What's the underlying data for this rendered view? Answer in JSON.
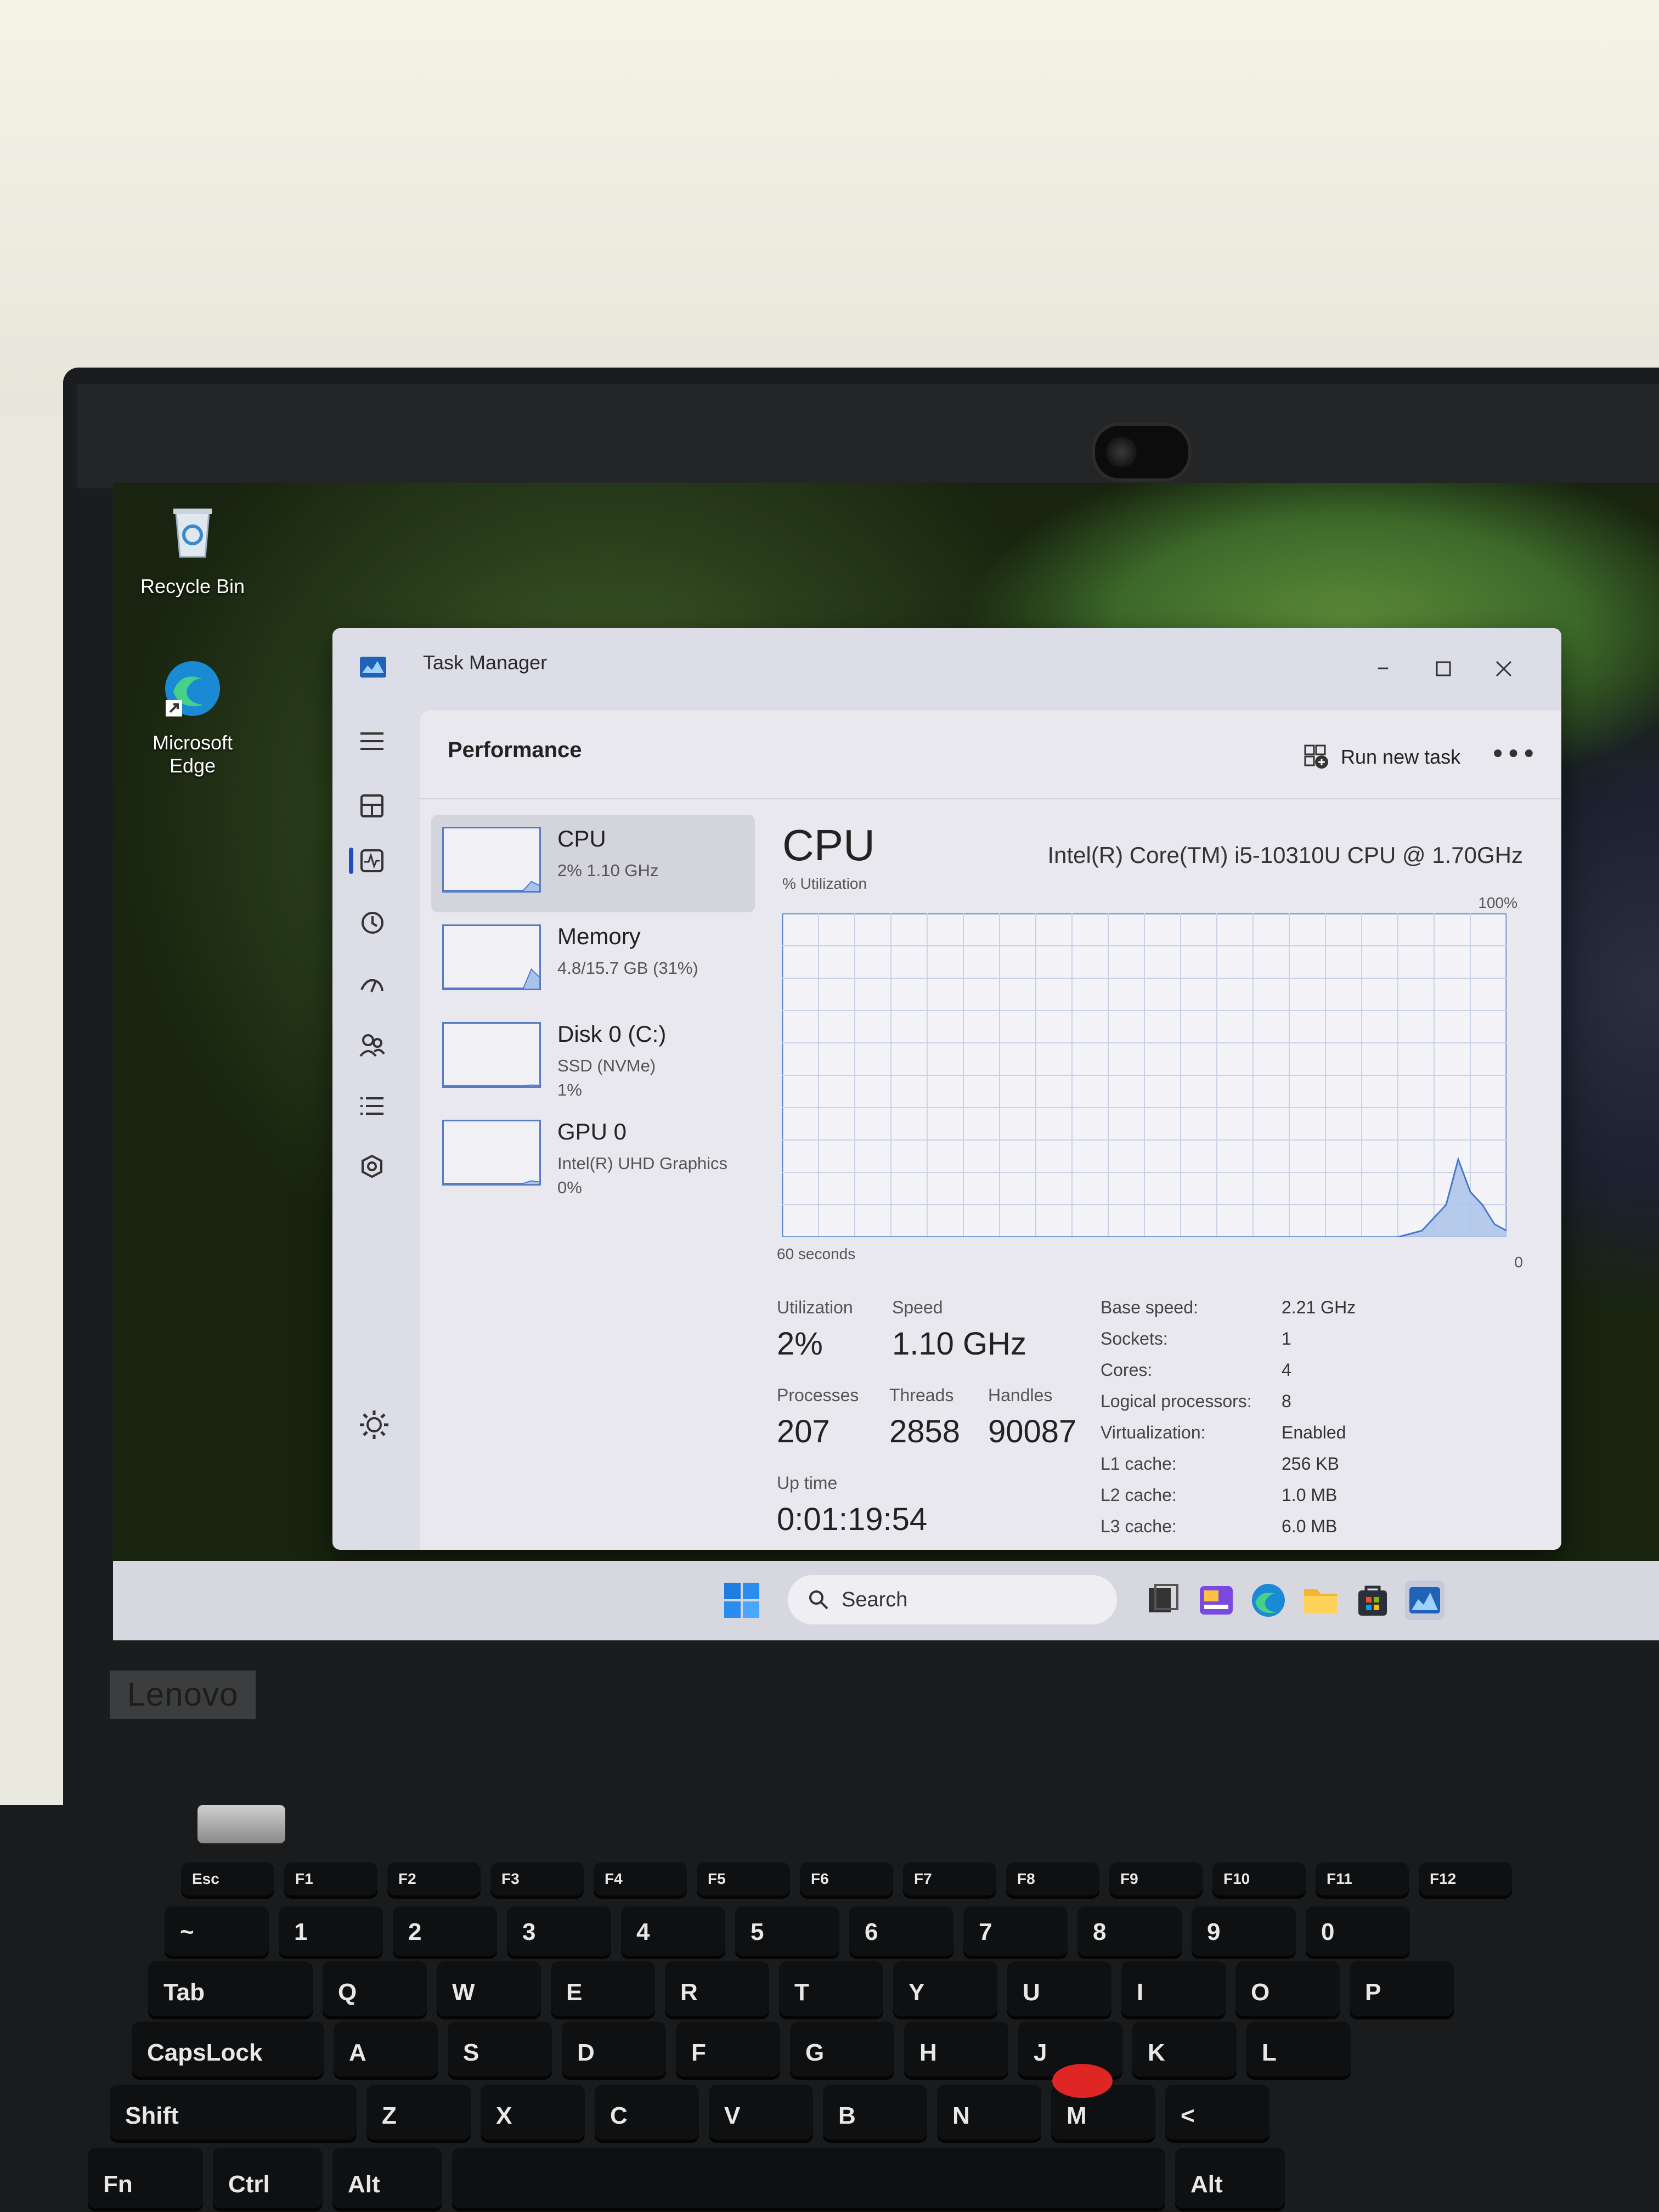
{
  "device": {
    "brand": "Lenovo"
  },
  "desktop": {
    "icons": [
      {
        "label": "Recycle Bin",
        "icon": "recycle-bin-icon"
      },
      {
        "label": "Microsoft Edge",
        "icon": "edge-icon"
      }
    ]
  },
  "window": {
    "title": "Task Manager",
    "controls": [
      "minimize",
      "maximize",
      "close"
    ]
  },
  "nav": {
    "items": [
      "hamburger-icon",
      "processes-icon",
      "performance-icon",
      "app-history-icon",
      "startup-apps-icon",
      "users-icon",
      "details-icon",
      "services-icon"
    ],
    "selected": "performance-icon",
    "footer": "settings-icon"
  },
  "page": {
    "title": "Performance",
    "run_new_task": "Run new task",
    "more": "•••"
  },
  "devices": [
    {
      "name": "CPU",
      "line1": "2% 1.10 GHz",
      "line2": "",
      "selected": true,
      "level": 0.15
    },
    {
      "name": "Memory",
      "line1": "4.8/15.7 GB (31%)",
      "line2": "",
      "selected": false,
      "level": 0.31
    },
    {
      "name": "Disk 0 (C:)",
      "line1": "SSD (NVMe)",
      "line2": "1%",
      "selected": false,
      "level": 0.02
    },
    {
      "name": "GPU 0",
      "line1": "Intel(R) UHD Graphics",
      "line2": "0%",
      "selected": false,
      "level": 0.05
    }
  ],
  "cpu": {
    "title": "CPU",
    "model": "Intel(R) Core(TM) i5-10310U CPU @ 1.70GHz",
    "util_label": "% Utilization",
    "max_label": "100%",
    "time_label": "60 seconds",
    "min_label": "0",
    "stats": {
      "utilization_label": "Utilization",
      "utilization": "2%",
      "speed_label": "Speed",
      "speed": "1.10 GHz",
      "processes_label": "Processes",
      "processes": "207",
      "threads_label": "Threads",
      "threads": "2858",
      "handles_label": "Handles",
      "handles": "90087",
      "uptime_label": "Up time",
      "uptime": "0:01:19:54"
    },
    "specs": [
      {
        "k": "Base speed:",
        "v": "2.21 GHz"
      },
      {
        "k": "Sockets:",
        "v": "1"
      },
      {
        "k": "Cores:",
        "v": "4"
      },
      {
        "k": "Logical processors:",
        "v": "8"
      },
      {
        "k": "Virtualization:",
        "v": "Enabled"
      },
      {
        "k": "L1 cache:",
        "v": "256 KB"
      },
      {
        "k": "L2 cache:",
        "v": "1.0 MB"
      },
      {
        "k": "L3 cache:",
        "v": "6.0 MB"
      }
    ]
  },
  "chart_data": {
    "type": "area",
    "ylim": [
      0,
      100
    ],
    "xlim": [
      60,
      0
    ],
    "x": [
      60,
      50,
      40,
      30,
      20,
      12,
      9,
      7,
      5,
      4,
      3,
      2,
      1,
      0
    ],
    "values": [
      0,
      0,
      0,
      0,
      0,
      0,
      0,
      2,
      10,
      24,
      14,
      10,
      4,
      2
    ],
    "grid": true
  },
  "taskbar": {
    "search_placeholder": "Search",
    "icons": [
      "start-icon",
      "search-icon",
      "task-view-icon",
      "news-icon",
      "edge-icon",
      "file-explorer-icon",
      "store-icon",
      "task-manager-icon"
    ]
  },
  "keyboard": {
    "rows": [
      [
        "Esc",
        "F1",
        "F2",
        "F3",
        "F4",
        "F5",
        "F6",
        "F7",
        "F8",
        "F9",
        "F10",
        "F11",
        "F12"
      ],
      [
        "~",
        "1",
        "2",
        "3",
        "4",
        "5",
        "6",
        "7",
        "8",
        "9",
        "0"
      ],
      [
        "Tab",
        "Q",
        "W",
        "E",
        "R",
        "T",
        "Y",
        "U",
        "I",
        "O",
        "P"
      ],
      [
        "CapsLock",
        "A",
        "S",
        "D",
        "F",
        "G",
        "H",
        "J",
        "K",
        "L"
      ],
      [
        "Shift",
        "Z",
        "X",
        "C",
        "V",
        "B",
        "N",
        "M",
        "<"
      ],
      [
        "Fn",
        "Ctrl",
        "Alt",
        "",
        "Alt"
      ]
    ]
  },
  "colors": {
    "accent": "#1f4fbf",
    "graph_line": "#4a78c8",
    "graph_fill": "#aac3ea"
  }
}
